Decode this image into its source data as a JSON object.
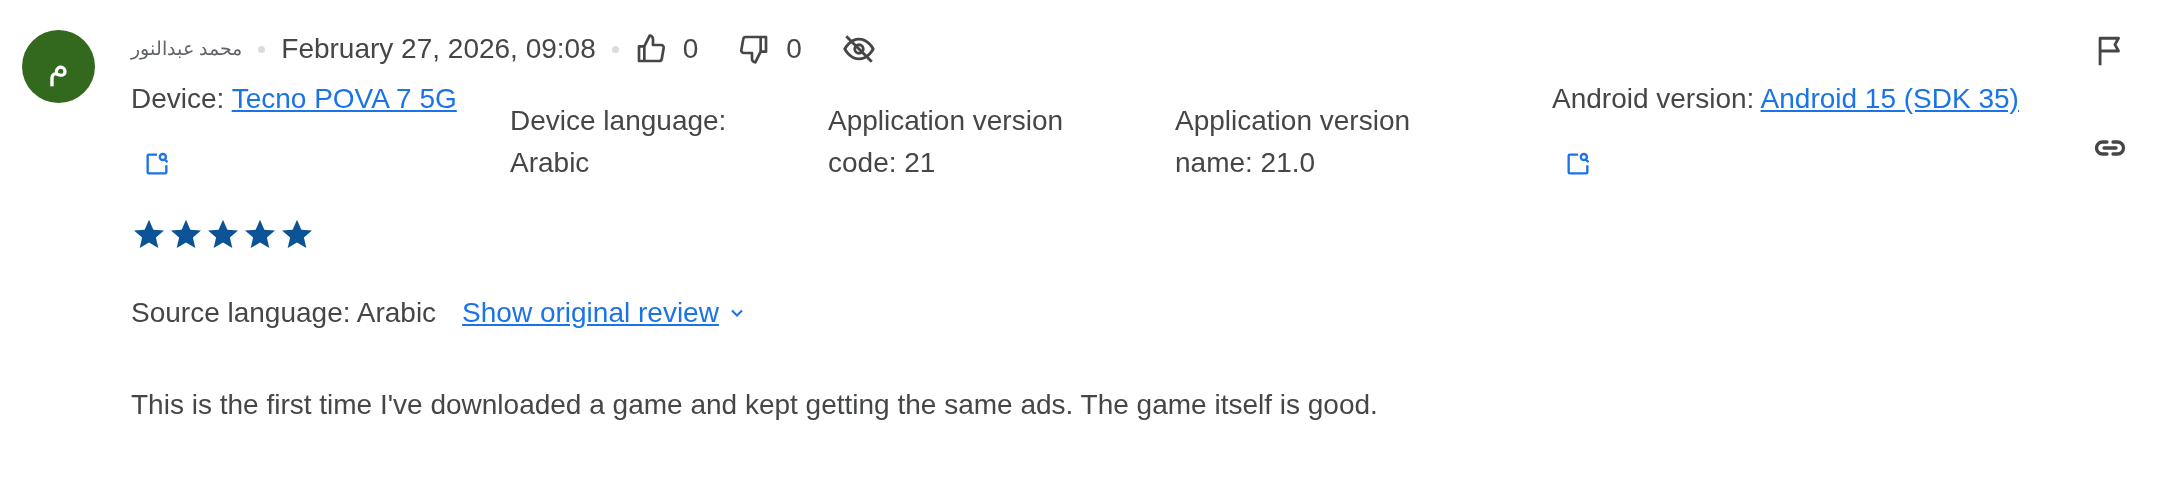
{
  "reviewer": {
    "avatar_letter": "م",
    "name": "محمد عبدالنور"
  },
  "date": "February 27, 2026, 09:08",
  "thumbs_up": "0",
  "thumbs_down": "0",
  "details": [
    {
      "kind": "link",
      "label": "Device:",
      "value": "Tecno POVA 7 5G"
    },
    {
      "kind": "text",
      "label": "Device language:",
      "value": "Arabic"
    },
    {
      "kind": "text",
      "label": "Application version code:",
      "value": "21"
    },
    {
      "kind": "text",
      "label": "Application version name:",
      "value": "21.0"
    },
    {
      "kind": "link",
      "label": "Android version:",
      "value": "Android 15 (SDK 35)"
    }
  ],
  "stars": 5,
  "source_language": "Source language: Arabic",
  "show_original": "Show original review",
  "review_text": "This is the first time I've downloaded a game and kept getting the same ads. The game itself is good."
}
